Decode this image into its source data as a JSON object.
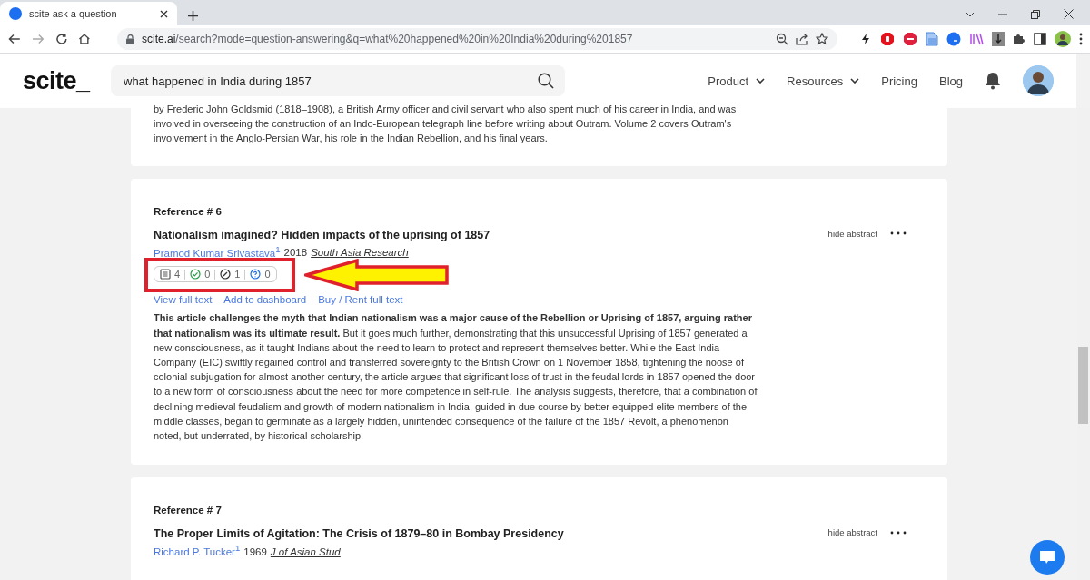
{
  "browser": {
    "tab_title": "scite ask a question",
    "url_host": "scite.ai",
    "url_path": "/search?mode=question-answering&q=what%20happened%20in%20India%20during%201857"
  },
  "header": {
    "logo": "scite_",
    "search": {
      "value": "what happened in India during 1857"
    },
    "nav": [
      {
        "label": "Product",
        "has_menu": true
      },
      {
        "label": "Resources",
        "has_menu": true
      },
      {
        "label": "Pricing",
        "has_menu": false
      },
      {
        "label": "Blog",
        "has_menu": false
      }
    ]
  },
  "results": [
    {
      "kind": "tail",
      "abstract": "by Frederic John Goldsmid (1818–1908), a British Army officer and civil servant who also spent much of his career in India, and was involved in overseeing the construction of an Indo-European telegraph line before writing about Outram. Volume 2 covers Outram's involvement in the Anglo-Persian War, his role in the Indian Rebellion, and his final years."
    },
    {
      "kind": "full",
      "reference": "Reference # 6",
      "title": "Nationalism imagined? Hidden impacts of the uprising of 1857",
      "author": "Pramod Kumar Srivastava",
      "author_mark": "1",
      "year": "2018",
      "journal": "South Asia Research",
      "toggle": "hide abstract",
      "highlighted": true,
      "tallies": [
        {
          "kind": "mentioning",
          "count": "4"
        },
        {
          "kind": "supporting",
          "count": "0"
        },
        {
          "kind": "contrasting",
          "count": "1"
        },
        {
          "kind": "unclassified",
          "count": "0"
        }
      ],
      "links": [
        "View full text",
        "Add to dashboard",
        "Buy / Rent full text"
      ],
      "abstract": "**This article challenges the myth that Indian nationalism was a major cause of the Rebellion or Uprising of 1857, arguing rather that nationalism was its ultimate result.** But it goes much further, demonstrating that this unsuccessful Uprising of 1857 generated a new consciousness, as it taught Indians about the need to learn to protect and represent themselves better. While the East India Company (EIC) swiftly regained control and transferred sovereignty to the British Crown on 1 November 1858, tightening the noose of colonial subjugation for almost another century, the article argues that significant loss of trust in the feudal lords in 1857 opened the door to a new form of consciousness about the need for more competence in self-rule. The analysis suggests, therefore, that a combination of declining medieval feudalism and growth of modern nationalism in India, guided in due course by better equipped elite members of the middle classes, began to germinate as a largely hidden, unintended consequence of the failure of the 1857 Revolt, a phenomenon noted, but underrated, by historical scholarship."
    },
    {
      "kind": "head",
      "reference": "Reference # 7",
      "title": "The Proper Limits of Agitation: The Crisis of 1879–80 in Bombay Presidency",
      "author": "Richard P. Tucker",
      "author_mark": "1",
      "year": "1969",
      "journal": "J of Asian Stud",
      "toggle": "hide abstract",
      "highlighted": false
    }
  ]
}
